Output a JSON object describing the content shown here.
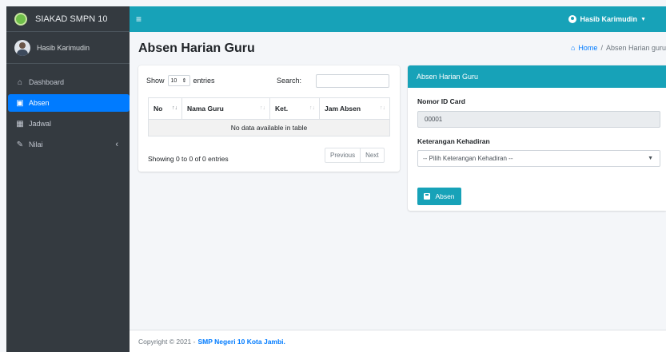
{
  "brand": {
    "name": "SIAKAD SMPN 10"
  },
  "sidebar": {
    "user_name": "Hasib Karimudin",
    "items": [
      {
        "label": "Dashboard",
        "icon": "home-icon"
      },
      {
        "label": "Absen",
        "icon": "calendar-check-icon",
        "active": true
      },
      {
        "label": "Jadwal",
        "icon": "calendar-icon"
      },
      {
        "label": "Nilai",
        "icon": "pencil-icon"
      }
    ]
  },
  "navbar": {
    "user_label": "Hasib Karimudin"
  },
  "header": {
    "title": "Absen Harian Guru",
    "breadcrumb_home": "Home",
    "breadcrumb_current": "Absen Harian guru"
  },
  "table_card": {
    "show_label": "Show",
    "length_value": "10",
    "entries_label": "entries",
    "search_label": "Search:",
    "search_value": "",
    "columns": [
      "No",
      "Nama Guru",
      "Ket.",
      "Jam Absen"
    ],
    "empty_message": "No data available in table",
    "info": "Showing 0 to 0 of 0 entries",
    "prev_label": "Previous",
    "next_label": "Next"
  },
  "form_card": {
    "title": "Absen Harian Guru",
    "id_label": "Nomor ID Card",
    "id_value": "00001",
    "ket_label": "Keterangan Kehadiran",
    "ket_placeholder": "-- Pilih Keterangan Kehadiran --",
    "submit_label": "Absen"
  },
  "footer": {
    "copyright": "Copyright © 2021 -",
    "link": "SMP Negeri 10 Kota Jambi."
  },
  "colors": {
    "sidebar_bg": "#343a40",
    "accent": "#17a2b8",
    "active": "#007bff"
  }
}
